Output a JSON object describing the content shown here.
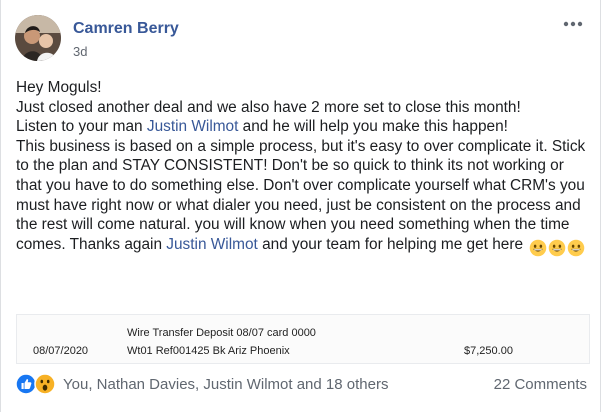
{
  "post": {
    "author": "Camren Berry",
    "timestamp": "3d",
    "more_icon": "ellipsis-icon",
    "body": {
      "line1": "Hey Moguls!",
      "line2": "Just closed another deal and we also have 2 more set to close this month!",
      "line3_pre": "Listen to your man ",
      "mention1": "Justin Wilmot",
      "line3_post": " and he will help you make this happen!",
      "para": "This business is based on a simple process, but it's easy to over complicate it. Stick to the plan and STAY CONSISTENT! Don't be so quick to think its not working or that you have to do something else. Don't over complicate yourself what CRM's you must have right now or what dialer you need, just be consistent on the process and the rest will come natural. you will know when you need something when the time comes. Thanks again ",
      "mention2": "Justin Wilmot",
      "closing": " and your team for helping me get here ",
      "emojis": [
        "grinning-face-icon",
        "grinning-face-icon",
        "grinning-face-icon"
      ]
    },
    "attachment": {
      "desc_line1": "Wire Transfer Deposit 08/07 card 0000",
      "date": "08/07/2020",
      "desc_line2": "Wt01 Ref001425 Bk Ariz Phoenix",
      "amount": "$7,250.00"
    },
    "footer": {
      "reaction_icons": [
        "like-icon",
        "wow-icon"
      ],
      "reactions_text": "You, Nathan Davies, Justin Wilmot and 18 others",
      "comments_text": "22 Comments"
    },
    "colors": {
      "link": "#385898",
      "text": "#1c1e21",
      "muted": "#606770",
      "like_blue": "#1877f2",
      "wow_yellow": "#f7b125"
    }
  }
}
